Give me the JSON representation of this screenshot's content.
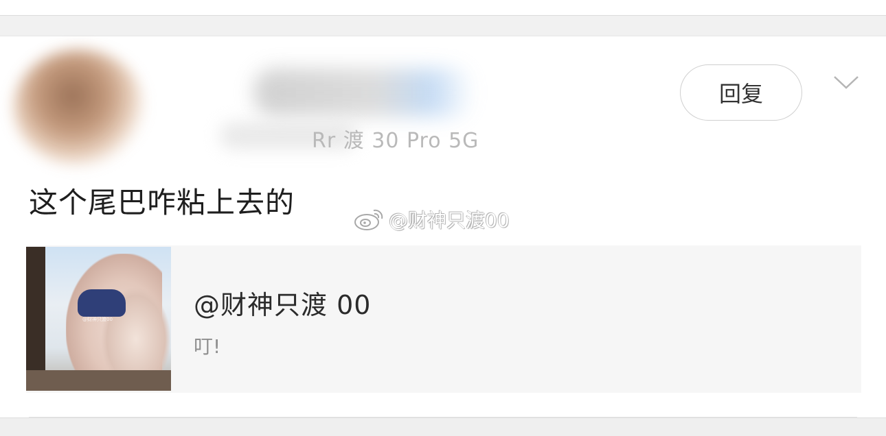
{
  "header": {
    "meta_text": "Rr 渡 30 Pro 5G"
  },
  "actions": {
    "reply_label": "回复"
  },
  "comment": {
    "text": "这个尾巴咋粘上去的"
  },
  "watermark": {
    "text": "@财神只渡00",
    "icon": "weibo-icon"
  },
  "quoted_post": {
    "username": "@财神只渡 00",
    "text": "叮!",
    "thumbnail_watermark": "@财神只渡00"
  },
  "colors": {
    "card_bg": "#ffffff",
    "band_gray": "#f1f1f1",
    "quote_bg": "#f6f6f6",
    "text_primary": "#1e1e1e",
    "text_secondary": "#8e8e8e"
  }
}
